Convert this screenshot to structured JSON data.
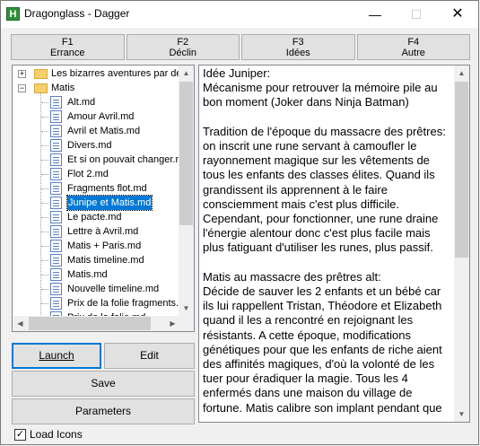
{
  "window": {
    "app_icon_letter": "H",
    "title": "Dragonglass - Dagger",
    "controls": {
      "minimize": "—",
      "maximize": "☐",
      "close": "✕"
    }
  },
  "fkeys": [
    {
      "key": "F1",
      "label": "Errance"
    },
    {
      "key": "F2",
      "label": "Déclin"
    },
    {
      "key": "F3",
      "label": "Idées"
    },
    {
      "key": "F4",
      "label": "Autre"
    }
  ],
  "tree": {
    "folders": [
      {
        "label": "Les bizarres aventures par dela",
        "expander": "+"
      },
      {
        "label": "Matis",
        "expander": "−"
      }
    ],
    "files": [
      "Alt.md",
      "Amour Avril.md",
      "Avril et Matis.md",
      "Divers.md",
      "Et si on pouvait changer.md",
      "Flot 2.md",
      "Fragments flot.md",
      "Junipe et Matis.md",
      "Le pacte.md",
      "Lettre à Avril.md",
      "Matis + Paris.md",
      "Matis timeline.md",
      "Matis.md",
      "Nouvelle timeline.md",
      "Prix de la folie fragments.md",
      "Prix de la folie.md"
    ],
    "selected_index": 7,
    "scroll": {
      "up": "▲",
      "down": "▼",
      "left": "◀",
      "right": "▶"
    }
  },
  "buttons": {
    "launch": "Launch",
    "edit": "Edit",
    "save": "Save",
    "parameters": "Parameters"
  },
  "editor": {
    "paragraphs": [
      "Idée Juniper:\nMécanisme pour retrouver la mémoire pile au bon moment (Joker dans Ninja Batman)",
      "Tradition de l'époque du massacre des prêtres:\non inscrit une rune servant à camoufler le rayonnement magique sur les vêtements de tous les enfants des classes élites. Quand ils grandissent ils apprennent à le faire consciemment mais c'est plus difficile. Cependant, pour fonctionner, une rune draine l'énergie alentour donc c'est plus facile mais plus fatiguant d'utiliser les runes, plus passif.",
      "Matis au massacre des prêtres alt:\nDécide de sauver les 2 enfants et un bébé car ils lui rappellent Tristan, Théodore et Elizabeth quand il les a rencontré en rejoignant les résistants. A cette époque, modifications génétiques pour que les enfants de riche aient des affinités magiques, d'où la volonté de les tuer pour éradiquer la magie. Tous les 4 enfermés dans une maison du village de fortune. Matis calibre son implant pendant que"
    ],
    "scroll": {
      "up": "▲",
      "down": "▼"
    }
  },
  "options": {
    "load_icons_label": "Load Icons",
    "load_icons_checked": true,
    "check_mark": "✓"
  }
}
